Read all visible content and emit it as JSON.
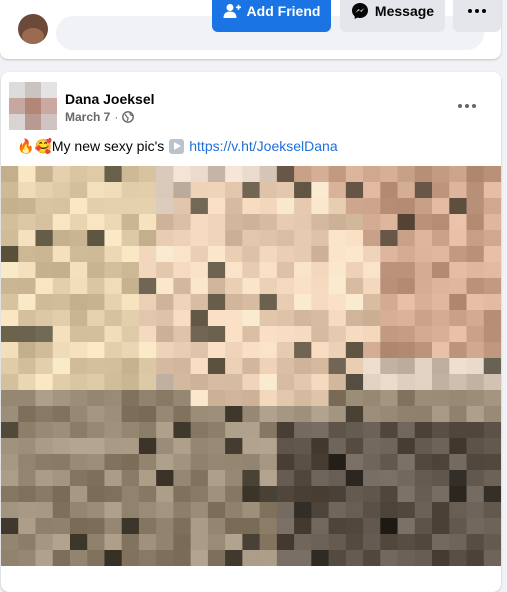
{
  "profile_header": {
    "add_friend_label": "Add Friend",
    "message_label": "Message",
    "icons": {
      "add_friend": "person-plus-icon",
      "message": "messenger-icon",
      "more": "more-dots-icon"
    },
    "colors": {
      "primary_button": "#1b74e4",
      "secondary_button": "#e4e6eb"
    }
  },
  "post": {
    "author": "Dana Joeksel",
    "date": "March 7",
    "separator": "·",
    "privacy_icon": "globe-icon",
    "emojis": [
      "🔥",
      "🥰"
    ],
    "text": "My new sexy pic's",
    "link_icon": "play-button-icon",
    "link": "https://v.ht/JoekselDana",
    "image_description_icon": "pixelated-photo",
    "colors": {
      "link": "#216fdb"
    }
  }
}
